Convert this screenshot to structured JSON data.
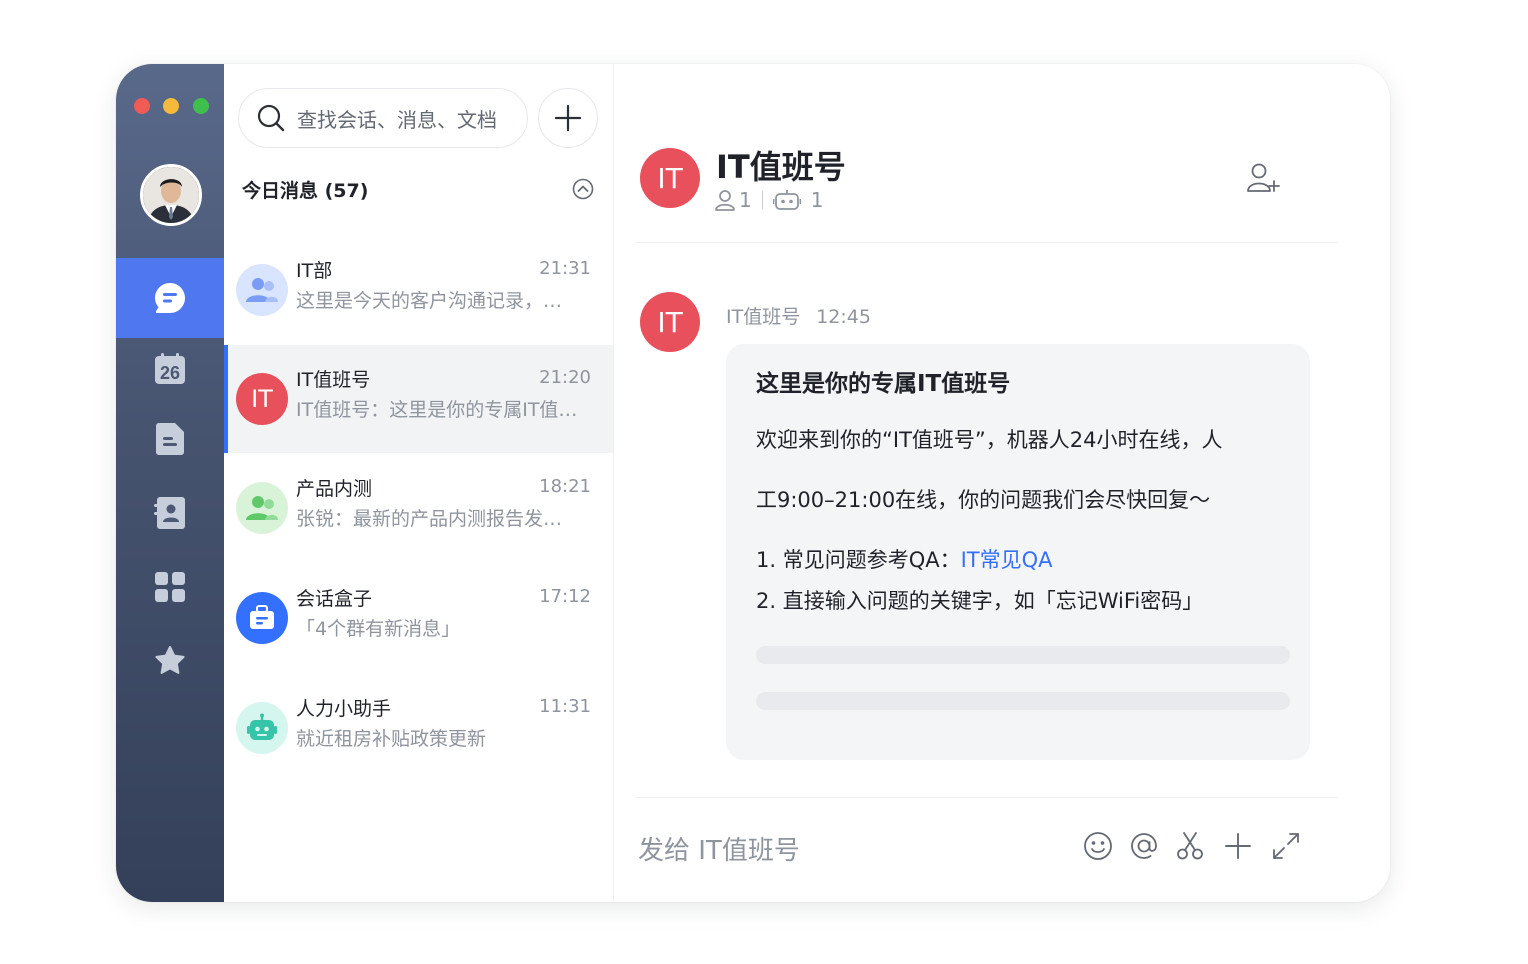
{
  "search": {
    "placeholder": "查找会话、消息、文档"
  },
  "list": {
    "section_title": "今日消息 (57)",
    "conversations": [
      {
        "name": "IT部",
        "time": "21:31",
        "preview": "这里是今天的客户沟通记录，…",
        "avatar_type": "group-icon",
        "avatar_color": "#d9e5ff"
      },
      {
        "name": "IT值班号",
        "time": "21:20",
        "preview": "IT值班号：这里是你的专属IT值…",
        "avatar_text": "IT",
        "avatar_color": "#e8505c"
      },
      {
        "name": "产品内测",
        "time": "18:21",
        "preview": "张锐：最新的产品内测报告发…",
        "avatar_type": "group-icon",
        "avatar_color": "#d9f3d9"
      },
      {
        "name": "会话盒子",
        "time": "17:12",
        "preview": "「4个群有新消息」",
        "avatar_type": "box-icon",
        "avatar_color": "#3370ff"
      },
      {
        "name": "人力小助手",
        "time": "11:31",
        "preview": "就近租房补贴政策更新",
        "avatar_type": "bot-icon",
        "avatar_color": "#d5f5ef"
      }
    ]
  },
  "chat": {
    "title": "IT值班号",
    "avatar_text": "IT",
    "member_count": "1",
    "bot_count": "1",
    "message": {
      "sender": "IT值班号",
      "time": "12:45",
      "title": "这里是你的专属IT值班号",
      "line1": "欢迎来到你的“IT值班号”，机器人24小时在线，人",
      "line2": "工9:00–21:00在线，你的问题我们会尽快回复～",
      "item1_prefix": "1. 常见问题参考QA：",
      "item1_link": "IT常见QA",
      "item2": "2. 直接输入问题的关键字，如「忘记WiFi密码」"
    },
    "composer_placeholder": "发给 IT值班号"
  },
  "colors": {
    "accent": "#3370ff",
    "rail_active": "#4f77f0",
    "it_avatar": "#e8505c"
  }
}
